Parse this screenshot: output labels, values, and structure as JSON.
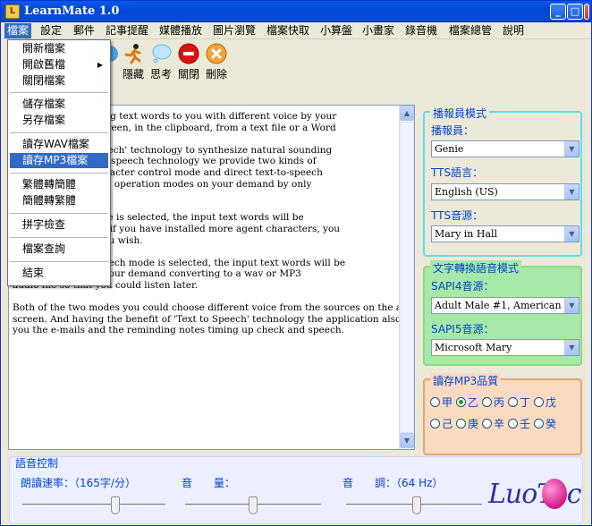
{
  "window": {
    "title": "LearnMate 1.0",
    "buttons": {
      "minimize": "_",
      "maximize": "□",
      "close": "×"
    }
  },
  "menu": [
    "檔案",
    "設定",
    "郵件",
    "記事提醒",
    "媒體播放",
    "圖片瀏覽",
    "檔案快取",
    "小算盤",
    "小畫家",
    "錄音機",
    "檔案總管",
    "說明"
  ],
  "file_menu": {
    "items": [
      "開新檔案",
      "開啟舊檔",
      "關閉檔案",
      "儲存檔案",
      "另存檔案",
      "讀存WAV檔案",
      "讀存MP3檔案",
      "繁體轉簡體",
      "簡體轉繁體",
      "拼字檢查",
      "檔案查詢",
      "結束"
    ],
    "highlighted": "讀存MP3檔案"
  },
  "toolbar": {
    "hide_label": "隱藏",
    "think_label": "思考",
    "close_label": "關閉",
    "delete_label": "刪除",
    "partial_label": "身"
  },
  "text_lines": [
    "pplication for reading text words to you with different voice by your",
    "ds may be on the screen, in the clipboard, from a text file or a Word",
    "",
    "icrosoft 'Text to Speech' technology to synthesize natural sounding",
    "ext. With the text-to-speech technology we provide two kinds of",
    "n are the agent character control mode and direct text-to-speech",
    "h between these two operation modes on your demand by only",
    "on.",
    "",
    "aracter control mode is selected, the input text words will be",
    "gent character. And if you have installed more agent characters, you",
    "to play for you as you wish.",
    "",
    "he direct text-to-speech mode is selected, the input text words will be",
    "audio output or by your demand converting to a wav or MP3",
    "audio file so that you could listen later.",
    "",
    "Both of the two modes you could choose different voice from the sources on the application",
    "screen. And having the benefit of 'Text to Speech' technology the application also provides",
    "you the e-mails and the reminding notes timing up check and speech."
  ],
  "announcer_group": {
    "title": "播報員模式",
    "announcer_label": "播報員：",
    "announcer_value": "Genie",
    "tts_lang_label": "TTS語言：",
    "tts_lang_value": "English (US)",
    "tts_source_label": "TTS音源：",
    "tts_source_value": "Mary in Hall"
  },
  "text_to_speech_group": {
    "title": "文字轉換語音模式",
    "sapi4_label": "SAPI4音源：",
    "sapi4_value": "Adult Male #1, American Engli",
    "sapi5_label": "SAPI5音源：",
    "sapi5_value": "Microsoft Mary"
  },
  "mp3_quality_group": {
    "title": "讀存MP3品質",
    "row1": [
      "甲",
      "乙",
      "丙",
      "丁",
      "戊"
    ],
    "row2": [
      "己",
      "庚",
      "辛",
      "壬",
      "癸"
    ],
    "selected": "乙"
  },
  "voice_control": {
    "title": "語音控制",
    "rate_label": "朗讀速率：（165字/分）",
    "rate_value": 0.65,
    "volume_label": "音　　量：",
    "volume_value": 0.5,
    "pitch_label": "音　　調：（64 Hz）",
    "pitch_value": 0.52
  },
  "logo_text": "LuoTec",
  "colors": {
    "title_blue": "#0a4bd0",
    "label_blue": "#0046d5",
    "menu_highlight": "#316ac5",
    "tts_green": "#a6e8a6",
    "mp3_peach": "#fbdbbf"
  }
}
